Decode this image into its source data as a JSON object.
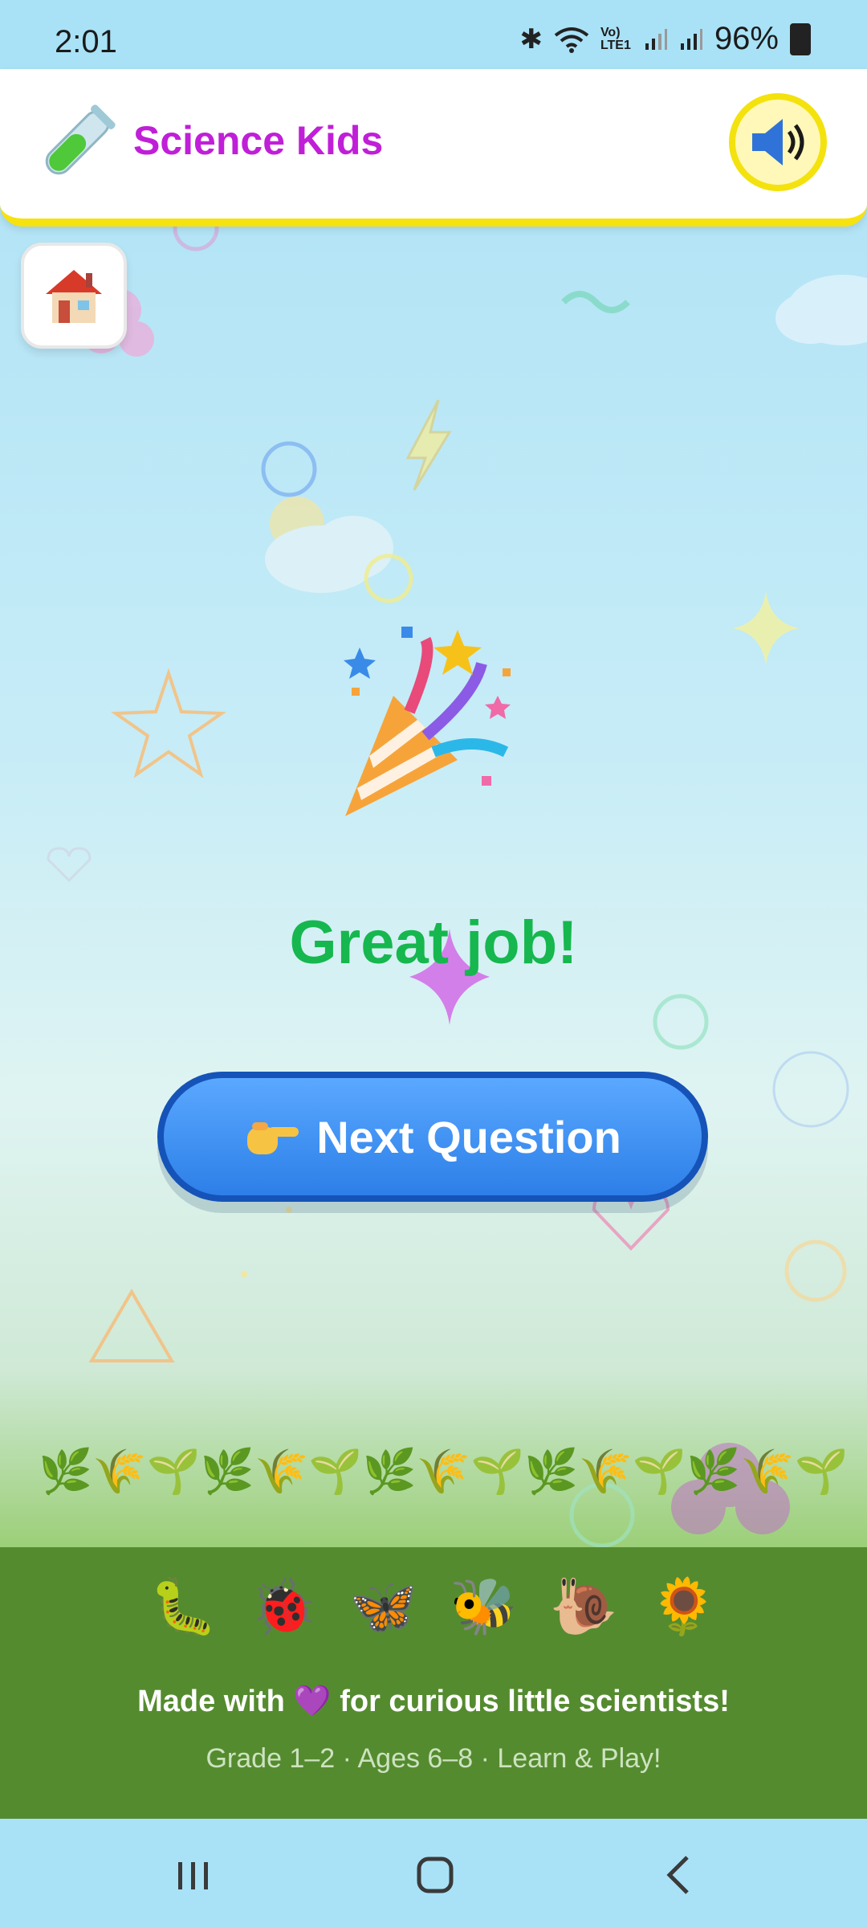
{
  "status_bar": {
    "time": "2:01",
    "battery": "96%",
    "network": "Vo) LTE1"
  },
  "header": {
    "title": "Science Kids",
    "logo_icon": "test-tube-icon",
    "sound_icon": "speaker-icon"
  },
  "home": {
    "icon": "house-icon"
  },
  "celebration": {
    "icon": "party-popper-icon",
    "message": "Great job!"
  },
  "next_button": {
    "icon": "pointing-hand-icon",
    "label": "Next Question"
  },
  "ground": {
    "plants": [
      "🌿",
      "🌾",
      "🌱",
      "🌿",
      "🌾",
      "🌱",
      "🌿",
      "🌾",
      "🌱",
      "🌿",
      "🌾",
      "🌱",
      "🌿",
      "🌾",
      "🌱"
    ]
  },
  "footer": {
    "critters": [
      "🐛",
      "🐞",
      "🦋",
      "🐝",
      "🐌",
      "🌻"
    ],
    "tagline": "Made with 💜 for curious little scientists!",
    "subtitle": "Grade 1–2 · Ages 6–8 · Learn & Play!"
  },
  "colors": {
    "title": "#c01fd8",
    "success": "#16b74e",
    "button": "#2d7fe8",
    "header_border": "#f6e20f",
    "footer": "#558b2f"
  }
}
